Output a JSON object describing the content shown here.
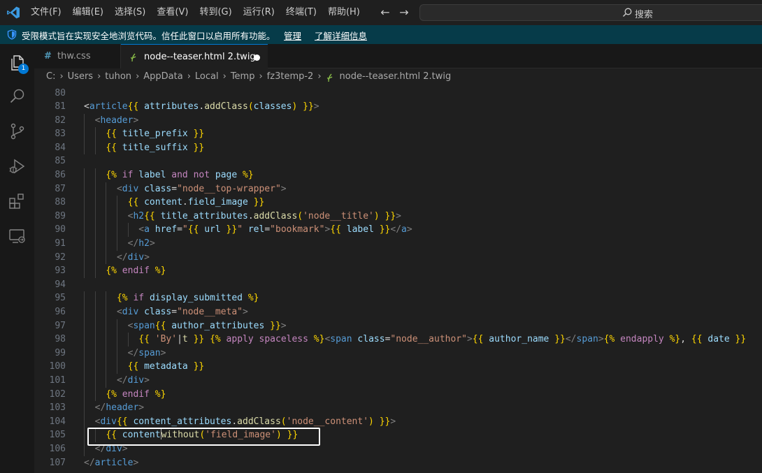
{
  "menu": [
    "文件(F)",
    "编辑(E)",
    "选择(S)",
    "查看(V)",
    "转到(G)",
    "运行(R)",
    "终端(T)",
    "帮助(H)"
  ],
  "search": {
    "placeholder": "搜索"
  },
  "banner": {
    "text": "受限模式旨在实现安全地浏览代码。信任此窗口以启用所有功能。",
    "manage": "管理",
    "learn_more": "了解详细信息"
  },
  "activity_bar": {
    "explorer_badge": "1"
  },
  "tabs": [
    {
      "label": "thw.css",
      "icon": "css-hash-icon"
    },
    {
      "label": "node--teaser.html 2.twig",
      "icon": "twig-icon",
      "modified": true
    }
  ],
  "breadcrumb": [
    "C:",
    "Users",
    "tuhon",
    "AppData",
    "Local",
    "Temp",
    "fz3temp-2",
    "node--teaser.html 2.twig"
  ],
  "editor": {
    "line_numbers": [
      "80",
      "81",
      "82",
      "83",
      "84",
      "85",
      "86",
      "87",
      "88",
      "89",
      "90",
      "91",
      "92",
      "93",
      "94",
      "95",
      "96",
      "97",
      "98",
      "99",
      "100",
      "101",
      "102",
      "103",
      "104",
      "105",
      "106",
      "107"
    ],
    "lines": [
      [],
      [
        [
          "t",
          "<"
        ],
        [
          "tag",
          "article"
        ],
        [
          "d",
          "{{"
        ],
        [
          "t",
          " "
        ],
        [
          "v",
          "attributes"
        ],
        [
          "t",
          "."
        ],
        [
          "fn",
          "addClass"
        ],
        [
          "d",
          "("
        ],
        [
          "v",
          "classes"
        ],
        [
          "d",
          ")"
        ],
        [
          "t",
          " "
        ],
        [
          "d",
          "}}"
        ],
        [
          "br",
          ">"
        ]
      ],
      [
        [
          "br",
          "<"
        ],
        [
          "tag",
          "header"
        ],
        [
          "br",
          ">"
        ]
      ],
      [
        [
          "d",
          "{{"
        ],
        [
          "t",
          " "
        ],
        [
          "v",
          "title_prefix"
        ],
        [
          "t",
          " "
        ],
        [
          "d",
          "}}"
        ]
      ],
      [
        [
          "d",
          "{{"
        ],
        [
          "t",
          " "
        ],
        [
          "v",
          "title_suffix"
        ],
        [
          "t",
          " "
        ],
        [
          "d",
          "}}"
        ]
      ],
      [],
      [
        [
          "d",
          "{%"
        ],
        [
          "t",
          " "
        ],
        [
          "kw",
          "if"
        ],
        [
          "t",
          " "
        ],
        [
          "v",
          "label"
        ],
        [
          "t",
          " "
        ],
        [
          "kw",
          "and"
        ],
        [
          "t",
          " "
        ],
        [
          "kw",
          "not"
        ],
        [
          "t",
          " "
        ],
        [
          "v",
          "page"
        ],
        [
          "t",
          " "
        ],
        [
          "d",
          "%}"
        ]
      ],
      [
        [
          "br",
          "<"
        ],
        [
          "tag",
          "div"
        ],
        [
          "t",
          " "
        ],
        [
          "attr",
          "class"
        ],
        [
          "t",
          "="
        ],
        [
          "str",
          "\"node__top-wrapper\""
        ],
        [
          "br",
          ">"
        ]
      ],
      [
        [
          "d",
          "{{"
        ],
        [
          "t",
          " "
        ],
        [
          "v",
          "content"
        ],
        [
          "t",
          "."
        ],
        [
          "v",
          "field_image"
        ],
        [
          "t",
          " "
        ],
        [
          "d",
          "}}"
        ]
      ],
      [
        [
          "br",
          "<"
        ],
        [
          "tag",
          "h2"
        ],
        [
          "d",
          "{{"
        ],
        [
          "t",
          " "
        ],
        [
          "v",
          "title_attributes"
        ],
        [
          "t",
          "."
        ],
        [
          "fn",
          "addClass"
        ],
        [
          "d",
          "("
        ],
        [
          "sq",
          "'node__title'"
        ],
        [
          "d",
          ")"
        ],
        [
          "t",
          " "
        ],
        [
          "d",
          "}}"
        ],
        [
          "br",
          ">"
        ]
      ],
      [
        [
          "br",
          "<"
        ],
        [
          "tag",
          "a"
        ],
        [
          "t",
          " "
        ],
        [
          "attr",
          "href"
        ],
        [
          "t",
          "="
        ],
        [
          "str",
          "\""
        ],
        [
          "d",
          "{{"
        ],
        [
          "t",
          " "
        ],
        [
          "v",
          "url"
        ],
        [
          "t",
          " "
        ],
        [
          "d",
          "}}"
        ],
        [
          "str",
          "\""
        ],
        [
          "t",
          " "
        ],
        [
          "attr",
          "rel"
        ],
        [
          "t",
          "="
        ],
        [
          "str",
          "\"bookmark\""
        ],
        [
          "br",
          ">"
        ],
        [
          "d",
          "{{"
        ],
        [
          "t",
          " "
        ],
        [
          "v",
          "label"
        ],
        [
          "t",
          " "
        ],
        [
          "d",
          "}}"
        ],
        [
          "br",
          "</"
        ],
        [
          "tag",
          "a"
        ],
        [
          "br",
          ">"
        ]
      ],
      [
        [
          "br",
          "</"
        ],
        [
          "tag",
          "h2"
        ],
        [
          "br",
          ">"
        ]
      ],
      [
        [
          "br",
          "</"
        ],
        [
          "tag",
          "div"
        ],
        [
          "br",
          ">"
        ]
      ],
      [
        [
          "d",
          "{%"
        ],
        [
          "t",
          " "
        ],
        [
          "kw",
          "endif"
        ],
        [
          "t",
          " "
        ],
        [
          "d",
          "%}"
        ]
      ],
      [],
      [
        [
          "d",
          "{%"
        ],
        [
          "t",
          " "
        ],
        [
          "kw",
          "if"
        ],
        [
          "t",
          " "
        ],
        [
          "v",
          "display_submitted"
        ],
        [
          "t",
          " "
        ],
        [
          "d",
          "%}"
        ]
      ],
      [
        [
          "br",
          "<"
        ],
        [
          "tag",
          "div"
        ],
        [
          "t",
          " "
        ],
        [
          "attr",
          "class"
        ],
        [
          "t",
          "="
        ],
        [
          "str",
          "\"node__meta\""
        ],
        [
          "br",
          ">"
        ]
      ],
      [
        [
          "br",
          "<"
        ],
        [
          "tag",
          "span"
        ],
        [
          "d",
          "{{"
        ],
        [
          "t",
          " "
        ],
        [
          "v",
          "author_attributes"
        ],
        [
          "t",
          " "
        ],
        [
          "d",
          "}}"
        ],
        [
          "br",
          ">"
        ]
      ],
      [
        [
          "d",
          "{{"
        ],
        [
          "t",
          " "
        ],
        [
          "sq",
          "'By'"
        ],
        [
          "t",
          "|"
        ],
        [
          "fn",
          "t"
        ],
        [
          "t",
          " "
        ],
        [
          "d",
          "}}"
        ],
        [
          "t",
          " "
        ],
        [
          "d",
          "{%"
        ],
        [
          "t",
          " "
        ],
        [
          "kw",
          "apply"
        ],
        [
          "t",
          " "
        ],
        [
          "kw",
          "spaceless"
        ],
        [
          "t",
          " "
        ],
        [
          "d",
          "%}"
        ],
        [
          "br",
          "<"
        ],
        [
          "tag",
          "span"
        ],
        [
          "t",
          " "
        ],
        [
          "attr",
          "class"
        ],
        [
          "t",
          "="
        ],
        [
          "str",
          "\"node__author\""
        ],
        [
          "br",
          ">"
        ],
        [
          "d",
          "{{"
        ],
        [
          "t",
          " "
        ],
        [
          "v",
          "author_name"
        ],
        [
          "t",
          " "
        ],
        [
          "d",
          "}}"
        ],
        [
          "br",
          "</"
        ],
        [
          "tag",
          "span"
        ],
        [
          "br",
          ">"
        ],
        [
          "d",
          "{%"
        ],
        [
          "t",
          " "
        ],
        [
          "kw",
          "endapply"
        ],
        [
          "t",
          " "
        ],
        [
          "d",
          "%}"
        ],
        [
          "t",
          ", "
        ],
        [
          "d",
          "{{"
        ],
        [
          "t",
          " "
        ],
        [
          "v",
          "date"
        ],
        [
          "t",
          " "
        ],
        [
          "d",
          "}}"
        ]
      ],
      [
        [
          "br",
          "</"
        ],
        [
          "tag",
          "span"
        ],
        [
          "br",
          ">"
        ]
      ],
      [
        [
          "d",
          "{{"
        ],
        [
          "t",
          " "
        ],
        [
          "v",
          "metadata"
        ],
        [
          "t",
          " "
        ],
        [
          "d",
          "}}"
        ]
      ],
      [
        [
          "br",
          "</"
        ],
        [
          "tag",
          "div"
        ],
        [
          "br",
          ">"
        ]
      ],
      [
        [
          "d",
          "{%"
        ],
        [
          "t",
          " "
        ],
        [
          "kw",
          "endif"
        ],
        [
          "t",
          " "
        ],
        [
          "d",
          "%}"
        ]
      ],
      [
        [
          "br",
          "</"
        ],
        [
          "tag",
          "header"
        ],
        [
          "br",
          ">"
        ]
      ],
      [
        [
          "br",
          "<"
        ],
        [
          "tag",
          "div"
        ],
        [
          "d",
          "{{"
        ],
        [
          "t",
          " "
        ],
        [
          "v",
          "content_attributes"
        ],
        [
          "t",
          "."
        ],
        [
          "fn",
          "addClass"
        ],
        [
          "d",
          "("
        ],
        [
          "sq",
          "'node__content'"
        ],
        [
          "d",
          ")"
        ],
        [
          "t",
          " "
        ],
        [
          "d",
          "}}"
        ],
        [
          "br",
          ">"
        ]
      ],
      [
        [
          "d",
          "{{"
        ],
        [
          "t",
          " "
        ],
        [
          "v",
          "content"
        ],
        [
          "t",
          "|"
        ],
        [
          "fn",
          "without"
        ],
        [
          "d",
          "("
        ],
        [
          "sq",
          "'field_image'"
        ],
        [
          "d",
          ")"
        ],
        [
          "t",
          " "
        ],
        [
          "d",
          "}}"
        ]
      ],
      [
        [
          "br",
          "</"
        ],
        [
          "tag",
          "div"
        ],
        [
          "br",
          ">"
        ]
      ],
      [
        [
          "br",
          "</"
        ],
        [
          "tag",
          "article"
        ],
        [
          "br",
          ">"
        ]
      ]
    ]
  },
  "colors": {
    "accent": "#0078d4",
    "banner_bg": "#063b49",
    "editor_bg": "#1f1f1f"
  }
}
